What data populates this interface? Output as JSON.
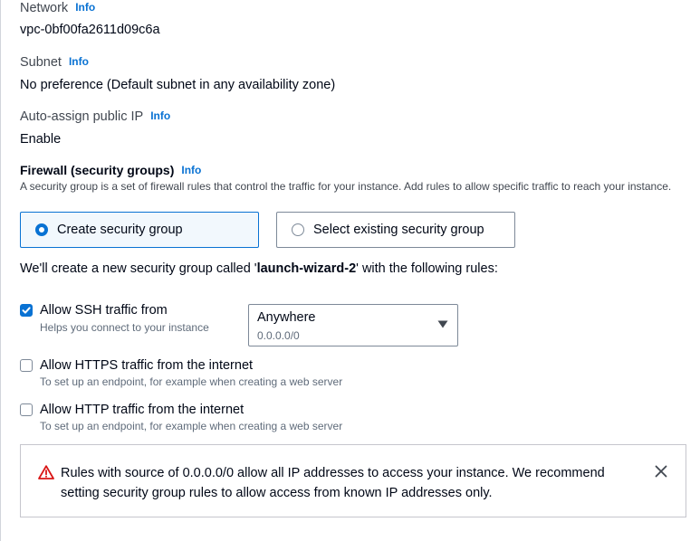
{
  "network": {
    "label": "Network",
    "info": "Info",
    "value": "vpc-0bf00fa2611d09c6a"
  },
  "subnet": {
    "label": "Subnet",
    "info": "Info",
    "value": "No preference (Default subnet in any availability zone)"
  },
  "public_ip": {
    "label": "Auto-assign public IP",
    "info": "Info",
    "value": "Enable"
  },
  "firewall": {
    "heading": "Firewall (security groups)",
    "info": "Info",
    "description": "A security group is a set of firewall rules that control the traffic for your instance. Add rules to allow specific traffic to reach your instance.",
    "options": [
      {
        "label": "Create security group",
        "selected": true
      },
      {
        "label": "Select existing security group",
        "selected": false
      }
    ],
    "rule_intro_prefix": "We'll create a new security group called '",
    "group_name": "launch-wizard-2",
    "rule_intro_suffix": "' with the following rules:"
  },
  "rules": [
    {
      "label": "Allow SSH traffic from",
      "description": "Helps you connect to your instance",
      "checked": true
    },
    {
      "label": "Allow HTTPS traffic from the internet",
      "description": "To set up an endpoint, for example when creating a web server",
      "checked": false
    },
    {
      "label": "Allow HTTP traffic from the internet",
      "description": "To set up an endpoint, for example when creating a web server",
      "checked": false
    }
  ],
  "ssh_source": {
    "value": "Anywhere",
    "description": "0.0.0.0/0"
  },
  "alert": {
    "type": "warning",
    "text": "Rules with source of 0.0.0.0/0 allow all IP addresses to access your instance. We recommend setting security group rules to allow access from known IP addresses only.",
    "icon_color": "#d91515"
  },
  "colors": {
    "link": "#0972d3",
    "checked": "#0972d3",
    "warning": "#d91515"
  }
}
